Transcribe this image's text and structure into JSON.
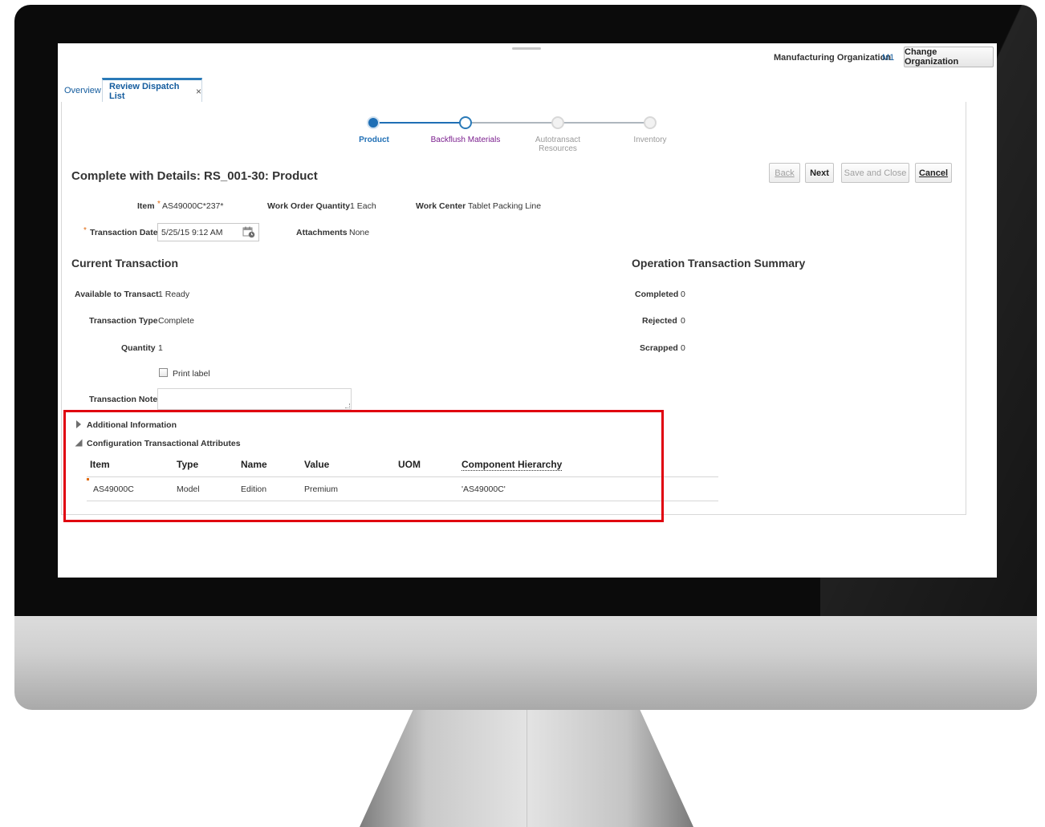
{
  "header": {
    "org_label": "Manufacturing Organization",
    "org_code": "M1",
    "change_org_button": "Change Organization"
  },
  "tabs": {
    "overview": "Overview",
    "active": "Review Dispatch List",
    "close_glyph": "×"
  },
  "train": {
    "steps": [
      {
        "label": "Product",
        "state": "done"
      },
      {
        "label": "Backflush Materials",
        "state": "current"
      },
      {
        "label": "Autotransact Resources",
        "state": "todo"
      },
      {
        "label": "Inventory",
        "state": "todo"
      }
    ],
    "colors": {
      "done": "#1f6fb5",
      "current_label": "#7b1f8e",
      "todo_label": "#9a9a9a"
    }
  },
  "page": {
    "title": "Complete with Details: RS_001-30: Product"
  },
  "buttons": {
    "back": "Back",
    "next": "Next",
    "save_close": "Save and Close",
    "cancel": "Cancel"
  },
  "details": {
    "item_label": "Item",
    "item_value": "AS49000C*237*",
    "woq_label": "Work Order Quantity",
    "woq_value": "1 Each",
    "wc_label": "Work Center",
    "wc_value": "Tablet Packing Line",
    "date_label": "Transaction Date",
    "date_value": "5/25/15 9:12 AM",
    "attachments_label": "Attachments",
    "attachments_value": "None",
    "required_marker": "*"
  },
  "current": {
    "title": "Current Transaction",
    "available_label": "Available to Transact",
    "available_value": "1 Ready",
    "type_label": "Transaction Type",
    "type_value": "Complete",
    "quantity_label": "Quantity",
    "quantity_value": "1",
    "print_label": "Print label",
    "note_label": "Transaction Note"
  },
  "summary": {
    "title": "Operation Transaction Summary",
    "completed_label": "Completed",
    "completed_value": "0",
    "rejected_label": "Rejected",
    "rejected_value": "0",
    "scrapped_label": "Scrapped",
    "scrapped_value": "0"
  },
  "sections": {
    "additional_info": "Additional Information",
    "config_attrs": "Configuration Transactional Attributes"
  },
  "attr_table": {
    "headers": [
      "Item",
      "Type",
      "Name",
      "Value",
      "UOM",
      "Component Hierarchy"
    ],
    "rows": [
      [
        "AS49000C",
        "Model",
        "Edition",
        "Premium",
        "",
        "'AS49000C'"
      ]
    ]
  },
  "icons": {
    "calendar": "calendar-icon",
    "expand": "triangle-right-icon",
    "collapse": "triangle-down-icon"
  },
  "highlight_color": "#e0000f"
}
